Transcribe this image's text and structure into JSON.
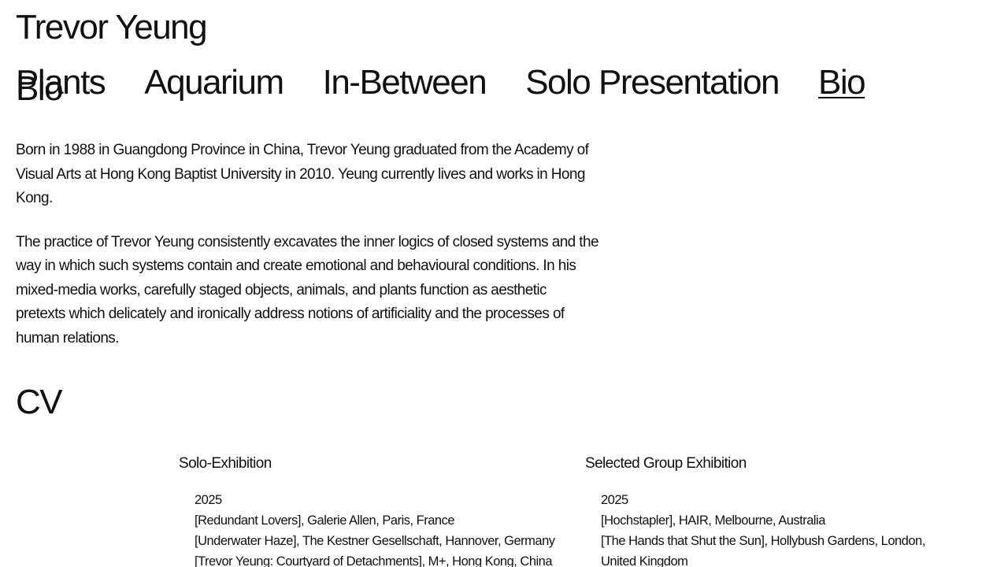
{
  "site": {
    "title": "Trevor Yeung"
  },
  "nav": {
    "items": [
      {
        "label": "Plants"
      },
      {
        "label": "Aquarium"
      },
      {
        "label": "In-Between"
      },
      {
        "label": "Solo Presentation"
      },
      {
        "label": "Bio"
      }
    ]
  },
  "bio": {
    "heading": "Bio",
    "paragraphs": [
      "Born in 1988 in Guangdong Province in China, Trevor Yeung graduated from the Academy of Visual Arts at Hong Kong Baptist University in 2010. Yeung currently lives and works in Hong Kong.",
      "The practice of Trevor Yeung consistently excavates the inner logics of closed systems and the way in which such systems contain and create emotional and behavioural conditions. In his mixed-media works, carefully staged objects, animals, and plants function as aesthetic pretexts which delicately and ironically address notions of artificiality and the processes of human relations."
    ]
  },
  "cv": {
    "heading": "CV",
    "solo": {
      "title": "Solo-Exhibition",
      "year": "2025",
      "items": [
        "[Redundant Lovers], Galerie Allen, Paris, France",
        "[Underwater Haze], The Kestner Gesellschaft, Hannover, Germany",
        "[Trevor Yeung: Courtyard of Detachments], M+, Hong Kong, China"
      ]
    },
    "group": {
      "title": "Selected Group Exhibition",
      "year": "2025",
      "items": [
        "[Hochstapler], HAIR, Melbourne, Australia",
        "[The Hands that Shut the Sun], Hollybush Gardens, London, United Kingdom"
      ]
    }
  }
}
